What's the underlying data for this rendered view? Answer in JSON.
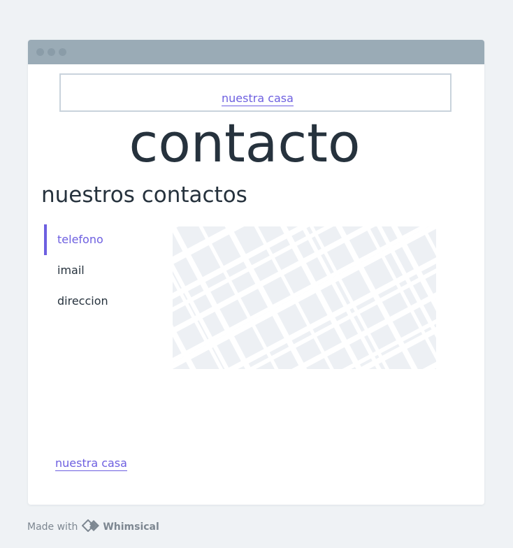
{
  "nav": {
    "link_label": "nuestra casa"
  },
  "page": {
    "title": "contacto",
    "section_title": "nuestros contactos"
  },
  "tabs": [
    {
      "label": "telefono",
      "active": true
    },
    {
      "label": "imail",
      "active": false
    },
    {
      "label": "direccion",
      "active": false
    }
  ],
  "footer": {
    "link_label": "nuestra casa"
  },
  "badge": {
    "prefix": "Made with",
    "brand": "Whimsical"
  },
  "icons": {
    "logo": "whimsical-logo-icon",
    "map": "map-placeholder-icon"
  },
  "colors": {
    "accent": "#6d5fe0",
    "titlebar": "#9aabb6",
    "text": "#26323d",
    "background": "#eff2f5"
  }
}
